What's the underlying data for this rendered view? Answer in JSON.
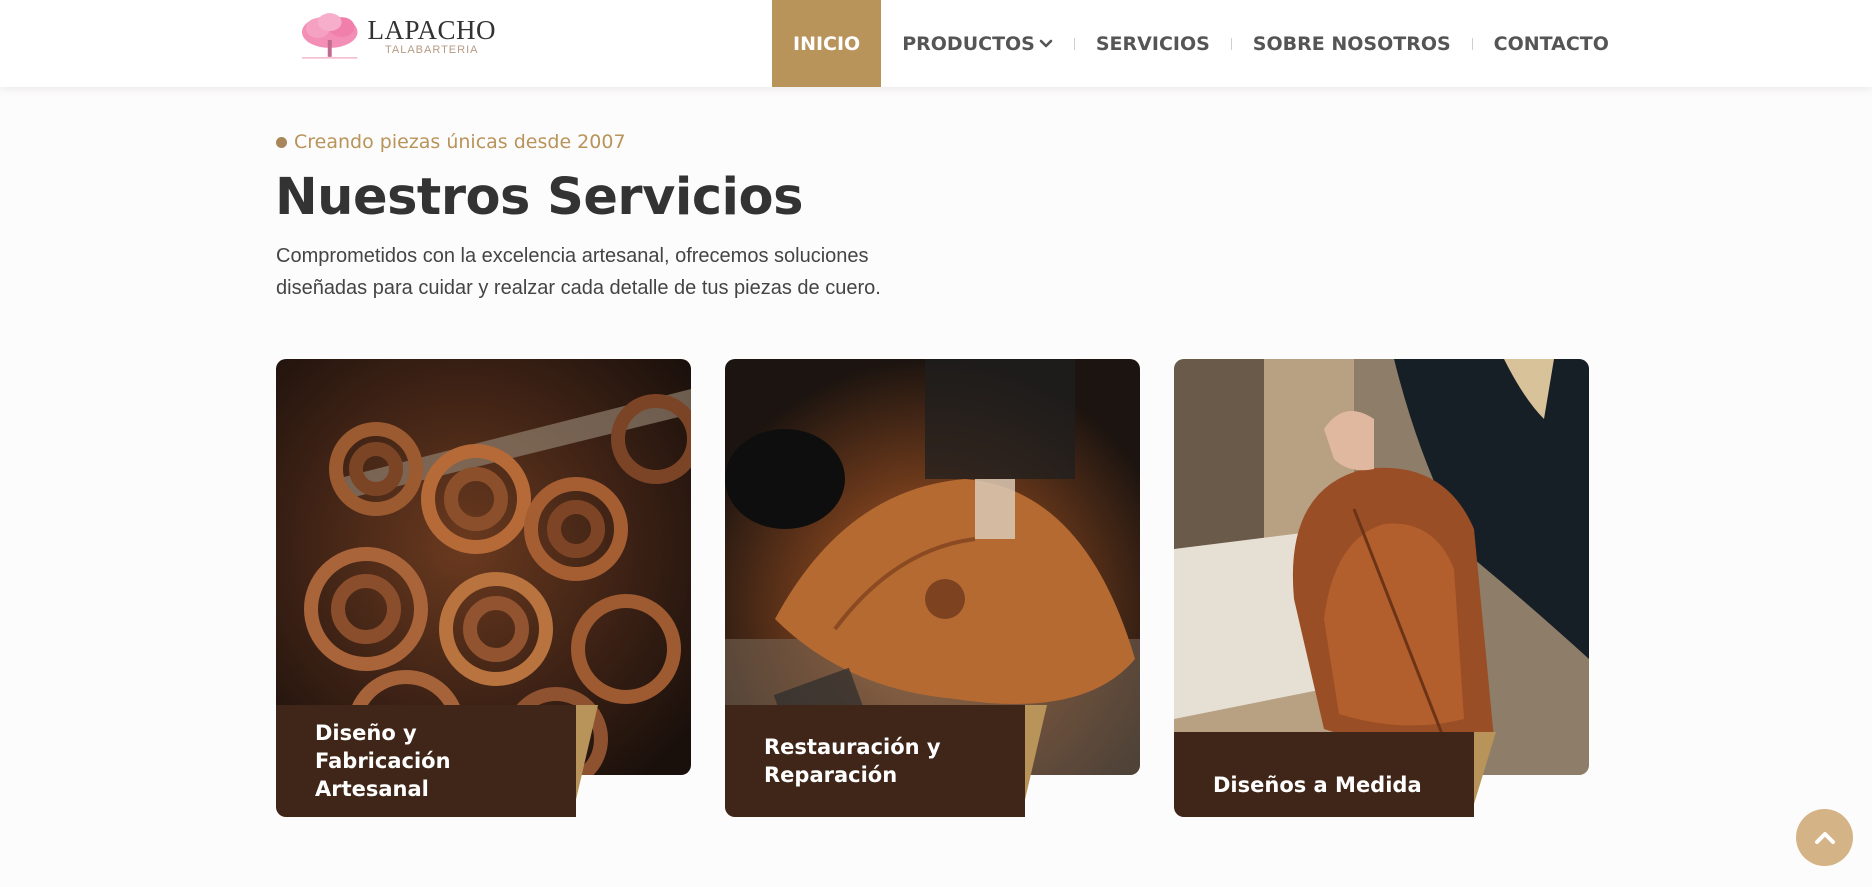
{
  "brand": {
    "name": "LAPACHO",
    "sub": "TALABARTERIA",
    "logo_icon": "pink-tree-logo"
  },
  "nav": {
    "items": [
      {
        "label": "INICIO",
        "active": true
      },
      {
        "label": "PRODUCTOS",
        "dropdown": true
      },
      {
        "label": "SERVICIOS"
      },
      {
        "label": "SOBRE NOSOTROS"
      },
      {
        "label": "CONTACTO"
      }
    ]
  },
  "hero": {
    "tagline": "Creando piezas únicas desde 2007",
    "title": "Nuestros Servicios",
    "description": "Comprometidos con la excelencia artesanal, ofrecemos soluciones diseñadas para cuidar y realzar cada detalle de tus piezas de cuero."
  },
  "services": [
    {
      "title": "Diseño y Fabricación Artesanal",
      "image": "rolled-leather-photo"
    },
    {
      "title": "Restauración y Reparación",
      "image": "sewing-machine-leather-photo"
    },
    {
      "title": "Diseños a Medida",
      "image": "leather-bag-photo"
    }
  ],
  "colors": {
    "accent": "#b8935a",
    "label_bg": "#3f2618",
    "scroll_button": "#d4b486"
  }
}
